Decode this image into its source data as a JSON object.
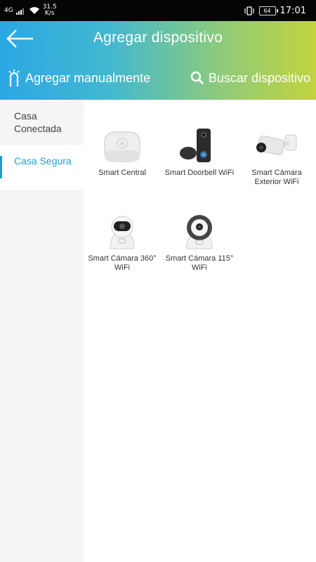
{
  "status_bar": {
    "network": "4G",
    "speed_value": "31.5",
    "speed_unit": "K/s",
    "battery": "64",
    "time": "17:01"
  },
  "header": {
    "title": "Agregar dispositivo",
    "back_icon": "arrow-left-icon",
    "manual_label": "Agregar manualmente",
    "manual_icon": "touch-icon",
    "search_label": "Buscar dispositivo",
    "search_icon": "search-icon",
    "gradient_start": "#2aa8e4",
    "gradient_end": "#c3d33e"
  },
  "sidebar": {
    "accent_color": "#1f9fcf",
    "items": [
      {
        "label": "Casa Conectada",
        "active": false
      },
      {
        "label": "Casa Segura",
        "active": true
      }
    ]
  },
  "devices": [
    {
      "label": "Smart Central",
      "icon": "hub-device-icon"
    },
    {
      "label": "Smart Doorbell WiFi",
      "icon": "doorbell-icon"
    },
    {
      "label": "Smart Cámara Exterior WiFi",
      "icon": "outdoor-camera-icon"
    },
    {
      "label": "Smart Cámara 360° WiFi",
      "icon": "pan-tilt-camera-icon"
    },
    {
      "label": "Smart Cámara 115° WiFi",
      "icon": "dome-camera-icon"
    }
  ]
}
